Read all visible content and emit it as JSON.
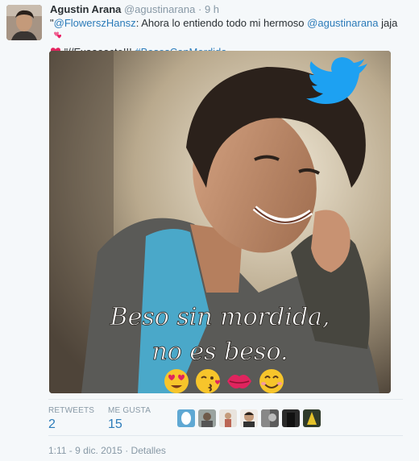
{
  "tweet": {
    "author_name": "Agustin Arana",
    "author_handle": "@agustinarana",
    "separator": "·",
    "time_ago": "9 h",
    "text": {
      "quote_open": "\"",
      "mention_1": "@FlowerszHansz",
      "text_1": ": Ahora lo entiendo todo mi hermoso ",
      "mention_2": "@agustinarana",
      "text_2": " jaja",
      "text_3": " \"//Exaaaacto!!! ",
      "hashtag": "#BesosConMordida"
    },
    "image_caption_line1": "Beso sin mordida,",
    "image_caption_line2": "no es beso.",
    "stats": {
      "retweets_label": "RETWEETS",
      "retweets_value": "2",
      "likes_label": "ME GUSTA",
      "likes_value": "15"
    },
    "timestamp": "1:11 - 9 dic. 2015",
    "timestamp_separator": "·",
    "details_link": "Detalles"
  },
  "colors": {
    "link": "#2b7bb9",
    "muted": "#8899a6",
    "twitter_bird": "#1da1f2",
    "heart": "#e0245e"
  }
}
